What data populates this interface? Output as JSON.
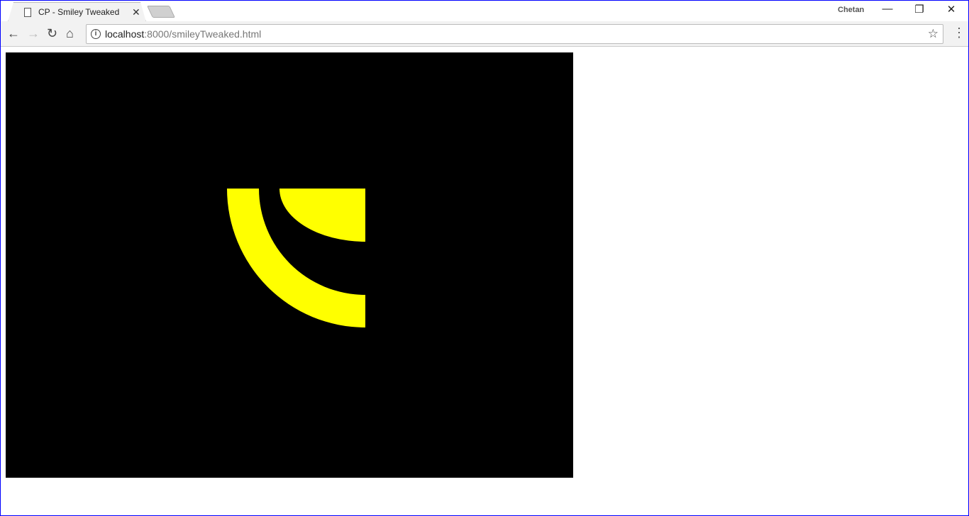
{
  "browser": {
    "tab_title": "CP - Smiley Tweaked",
    "user": "Chetan",
    "url_host": "localhost",
    "url_rest": ":8000/smileyTweaked.html"
  },
  "icons": [
    "document-icon",
    "close-icon",
    "back-icon",
    "forward-icon",
    "reload-icon",
    "home-icon",
    "info-icon",
    "star-icon",
    "menu-icon",
    "minimize-icon",
    "restore-icon"
  ],
  "colors": {
    "canvas": "#000000",
    "smiley": "#ffff00"
  }
}
